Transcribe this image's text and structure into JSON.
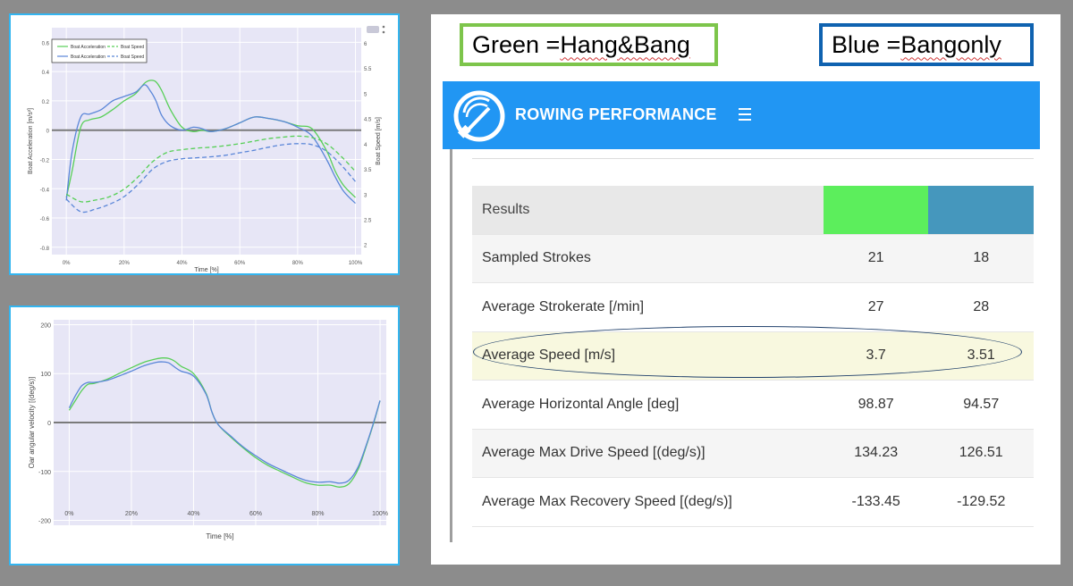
{
  "chart_data": [
    {
      "type": "line",
      "xlabel": "Time [%]",
      "ylabel": "Boat Acceleration [m/s²]",
      "y2label": "Boat Speed [m/s]",
      "xlim": [
        -5,
        102
      ],
      "ylim": [
        -0.85,
        0.7
      ],
      "y2lim": [
        1.8,
        6.3
      ],
      "x_ticks": [
        "0%",
        "20%",
        "40%",
        "60%",
        "80%",
        "100%"
      ],
      "y_ticks": [
        "0.6",
        "0.4",
        "0.2",
        "0",
        "-0.2",
        "-0.4",
        "-0.6",
        "-0.8"
      ],
      "y2_ticks": [
        "6",
        "5.5",
        "5",
        "4.5",
        "4",
        "3.5",
        "3",
        "2.5",
        "2"
      ],
      "grid": true,
      "legend": "top-left",
      "series": [
        {
          "name": "Boat Acceleration",
          "axis": "y",
          "color": "#57cf57",
          "dash": false,
          "x": [
            0,
            2,
            5,
            8,
            12,
            16,
            20,
            24,
            27,
            29,
            31,
            33,
            36,
            40,
            44,
            47,
            50,
            55,
            60,
            65,
            70,
            75,
            80,
            85,
            90,
            93,
            96,
            100
          ],
          "y": [
            -0.46,
            -0.28,
            0.02,
            0.07,
            0.09,
            0.14,
            0.2,
            0.25,
            0.32,
            0.34,
            0.33,
            0.27,
            0.14,
            0.02,
            -0.01,
            0.0,
            -0.01,
            0.01,
            0.05,
            0.09,
            0.08,
            0.06,
            0.03,
            0.01,
            -0.14,
            -0.28,
            -0.38,
            -0.46
          ]
        },
        {
          "name": "Boat Acceleration",
          "axis": "y",
          "color": "#5a86d8",
          "dash": false,
          "x": [
            0,
            2,
            5,
            8,
            12,
            16,
            20,
            24,
            27,
            29,
            31,
            33,
            36,
            40,
            44,
            47,
            50,
            55,
            60,
            65,
            70,
            75,
            80,
            85,
            90,
            93,
            96,
            100
          ],
          "y": [
            -0.48,
            -0.15,
            0.09,
            0.11,
            0.14,
            0.2,
            0.23,
            0.26,
            0.31,
            0.27,
            0.2,
            0.1,
            0.03,
            0.0,
            0.02,
            0.01,
            -0.01,
            0.01,
            0.05,
            0.09,
            0.08,
            0.06,
            0.02,
            -0.04,
            -0.2,
            -0.32,
            -0.42,
            -0.5
          ]
        },
        {
          "name": "Boat Speed",
          "axis": "y2",
          "color": "#57cf57",
          "dash": true,
          "x": [
            0,
            5,
            10,
            15,
            20,
            25,
            30,
            35,
            40,
            45,
            50,
            55,
            60,
            65,
            70,
            75,
            80,
            85,
            90,
            95,
            100
          ],
          "y": [
            3.0,
            2.85,
            2.88,
            2.95,
            3.1,
            3.35,
            3.65,
            3.83,
            3.88,
            3.91,
            3.93,
            3.96,
            4.0,
            4.05,
            4.1,
            4.13,
            4.15,
            4.12,
            4.0,
            3.75,
            3.45
          ]
        },
        {
          "name": "Boat Speed",
          "axis": "y2",
          "color": "#5a86d8",
          "dash": true,
          "x": [
            0,
            5,
            10,
            15,
            20,
            25,
            30,
            35,
            40,
            45,
            50,
            55,
            60,
            65,
            70,
            75,
            80,
            85,
            90,
            95,
            100
          ],
          "y": [
            2.9,
            2.65,
            2.7,
            2.8,
            2.95,
            3.2,
            3.5,
            3.65,
            3.7,
            3.72,
            3.74,
            3.77,
            3.82,
            3.87,
            3.93,
            3.98,
            4.0,
            3.98,
            3.85,
            3.58,
            3.25
          ]
        }
      ]
    },
    {
      "type": "line",
      "xlabel": "Time [%]",
      "ylabel": "Oar angular velocity [(deg/s)]",
      "xlim": [
        -5,
        102
      ],
      "ylim": [
        -210,
        210
      ],
      "x_ticks": [
        "0%",
        "20%",
        "40%",
        "60%",
        "80%",
        "100%"
      ],
      "y_ticks": [
        "200",
        "100",
        "0",
        "-100",
        "-200"
      ],
      "grid": true,
      "series": [
        {
          "color": "#57cf57",
          "x": [
            0,
            2,
            4,
            6,
            8,
            12,
            16,
            20,
            24,
            28,
            30,
            32,
            34,
            36,
            40,
            44,
            46,
            48,
            52,
            56,
            60,
            64,
            68,
            72,
            76,
            80,
            84,
            87,
            90,
            93,
            96,
            98,
            100
          ],
          "y": [
            25,
            45,
            65,
            78,
            80,
            88,
            100,
            112,
            123,
            130,
            132,
            131,
            125,
            115,
            100,
            60,
            20,
            -5,
            -30,
            -52,
            -72,
            -88,
            -100,
            -112,
            -123,
            -128,
            -128,
            -132,
            -125,
            -95,
            -40,
            0,
            45
          ]
        },
        {
          "color": "#5a86d8",
          "x": [
            0,
            2,
            4,
            6,
            8,
            12,
            16,
            20,
            24,
            28,
            30,
            32,
            34,
            36,
            40,
            44,
            46,
            48,
            52,
            56,
            60,
            64,
            68,
            72,
            76,
            80,
            84,
            87,
            90,
            93,
            96,
            98,
            100
          ],
          "y": [
            30,
            55,
            75,
            82,
            82,
            86,
            95,
            105,
            116,
            123,
            124,
            122,
            113,
            105,
            95,
            58,
            20,
            -5,
            -28,
            -50,
            -68,
            -84,
            -96,
            -108,
            -118,
            -122,
            -121,
            -124,
            -118,
            -90,
            -38,
            2,
            45
          ]
        }
      ]
    }
  ],
  "legend_green": {
    "prefix": "Green = ",
    "word": "Hang&Bang"
  },
  "legend_blue": {
    "prefix": "Blue = ",
    "word": "Bang",
    "suffix": " only"
  },
  "app": {
    "title": "ROWING PERFORMANCE"
  },
  "results": {
    "header": "Results",
    "group_colors": [
      "#5cee5c",
      "#4597bd"
    ],
    "rows": [
      {
        "label": "Sampled Strokes",
        "green": "21",
        "blue": "18"
      },
      {
        "label": "Average Strokerate [/min]",
        "green": "27",
        "blue": "28"
      },
      {
        "label": "Average Speed [m/s]",
        "green": "3.7",
        "blue": "3.51"
      },
      {
        "label": "Average Horizontal Angle [deg]",
        "green": "98.87",
        "blue": "94.57"
      },
      {
        "label": "Average Max Drive Speed [(deg/s)]",
        "green": "134.23",
        "blue": "126.51"
      },
      {
        "label": "Average Max Recovery Speed [(deg/s)]",
        "green": "-133.45",
        "blue": "-129.52"
      }
    ]
  }
}
